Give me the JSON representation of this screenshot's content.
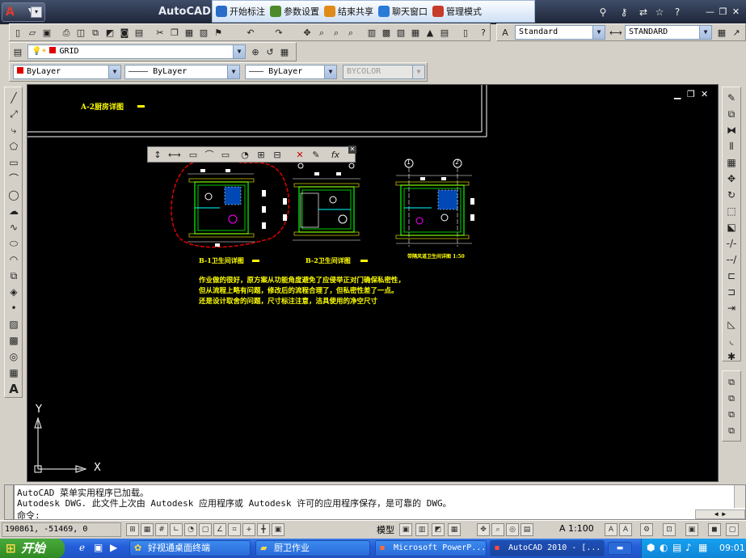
{
  "window": {
    "title": "AutoCAD 2",
    "logo_letter": "A"
  },
  "meeting_bar": {
    "items": [
      {
        "label": "开始标注",
        "icon": "pen-icon",
        "color": "#2a6cc8"
      },
      {
        "label": "参数设置",
        "icon": "gear-icon",
        "color": "#4c8a2a"
      },
      {
        "label": "结束共享",
        "icon": "stop-share-icon",
        "color": "#e08a1a"
      },
      {
        "label": "聊天窗口",
        "icon": "chat-icon",
        "color": "#2a7ad8"
      },
      {
        "label": "管理模式",
        "icon": "user-icon",
        "color": "#c83a2a"
      }
    ]
  },
  "toolbars": {
    "text_style": "Standard",
    "dim_style": "STANDARD",
    "layer": "GRID",
    "color": "ByLayer",
    "linetype": "———— ByLayer",
    "lineweight": "——— ByLayer",
    "plotstyle": "BYCOLOR"
  },
  "drawing": {
    "title_a2": "A-2厨房详图",
    "label_b1": "B-1卫生间详图",
    "label_b2": "B-2卫生间详图",
    "label_b3": "带隔风道卫生间详图",
    "label_b3_scale": "1:50",
    "grid_1": "1",
    "grid_2": "2",
    "note_lines": [
      "作业做的很好，原方案从功能角度避免了应侵举正对门确保私密性，",
      "但从流程上略有问题，修改后的流程合理了，但私密性差了一点。",
      "还是设计取舍的问题，尺寸标注注意，洁具使用的净空尺寸"
    ],
    "axis_x": "X",
    "axis_y": "Y"
  },
  "command": {
    "line1": "AutoCAD 菜单实用程序已加载。",
    "line2": "Autodesk DWG.   此文件上次由 Autodesk 应用程序或 Autodesk 许可的应用程序保存，是可靠的 DWG。",
    "prompt": "命令:"
  },
  "status": {
    "coords": "190861, -51469, 0",
    "model_label": "模型",
    "scale": "A 1:100"
  },
  "taskbar": {
    "start": "开始",
    "tasks": [
      {
        "label": "好视通桌面终端"
      },
      {
        "label": "厨卫作业"
      },
      {
        "label": "Microsoft PowerP..."
      },
      {
        "label": "AutoCAD 2010 - [..."
      }
    ],
    "clock": "09:01"
  }
}
